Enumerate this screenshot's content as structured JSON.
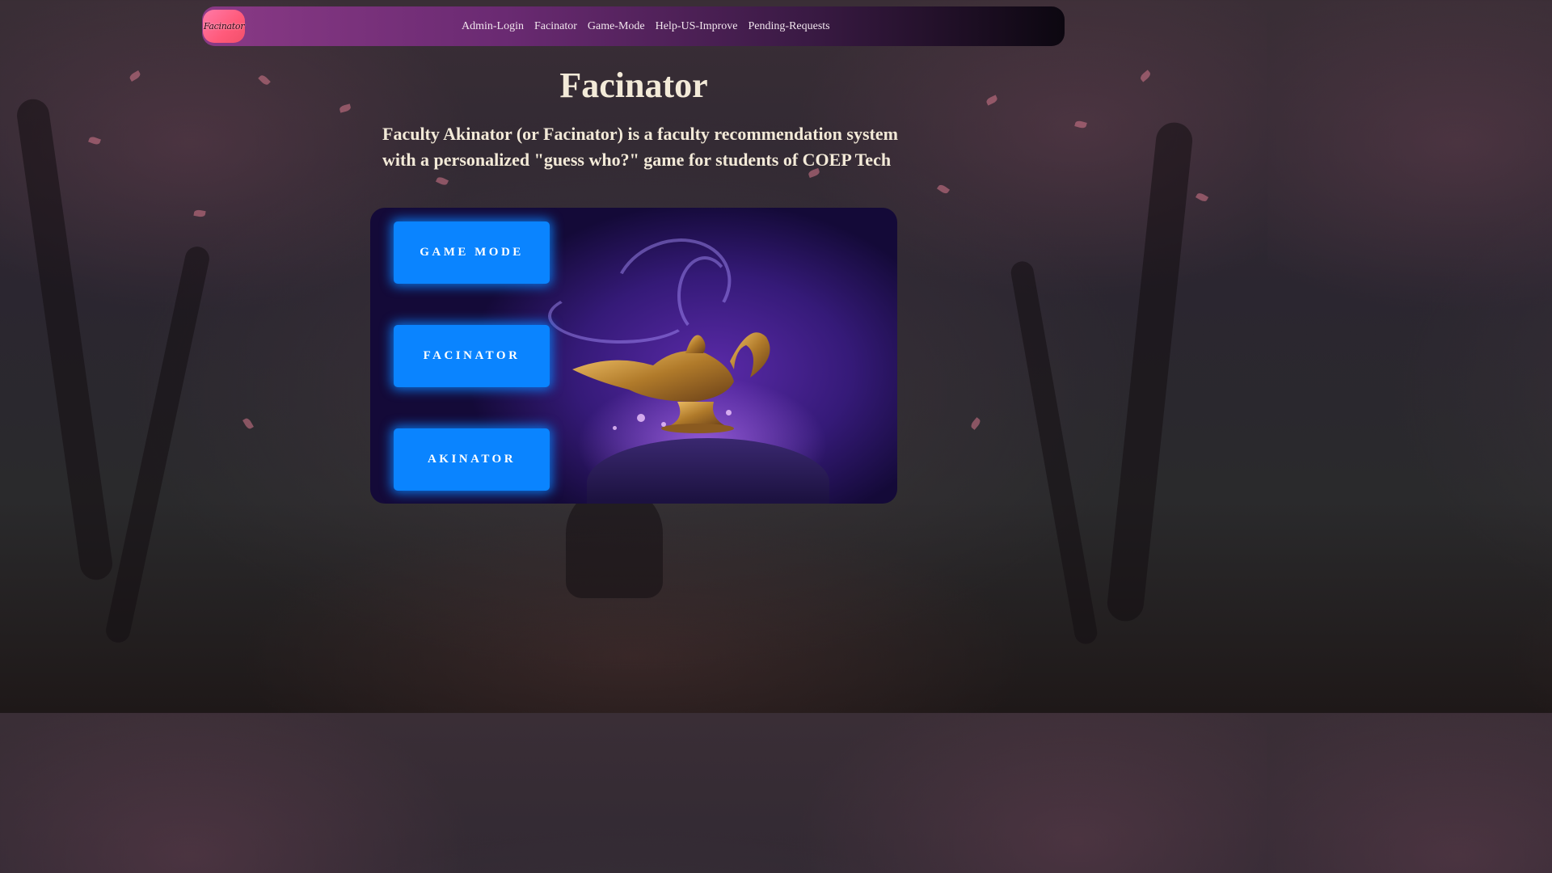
{
  "navbar": {
    "logo_text": "Facinator",
    "links": [
      {
        "label": "Admin-Login"
      },
      {
        "label": "Facinator"
      },
      {
        "label": "Game-Mode"
      },
      {
        "label": "Help-US-Improve"
      },
      {
        "label": "Pending-Requests"
      }
    ]
  },
  "main": {
    "title": "Facinator",
    "description": "Faculty Akinator (or Facinator) is a faculty recommendation system with a personalized \"guess who?\" game for students of COEP Tech"
  },
  "card": {
    "image_icon": "magic-lamp-illustration",
    "buttons": [
      {
        "label": "GAME MODE"
      },
      {
        "label": "FACINATOR"
      },
      {
        "label": "AKINATOR"
      }
    ]
  },
  "colors": {
    "button": "#0a84ff",
    "text": "#f3ead8",
    "navbar_start": "#8a3a86",
    "navbar_end": "#0c0710",
    "logo": "#ff5a7a"
  }
}
